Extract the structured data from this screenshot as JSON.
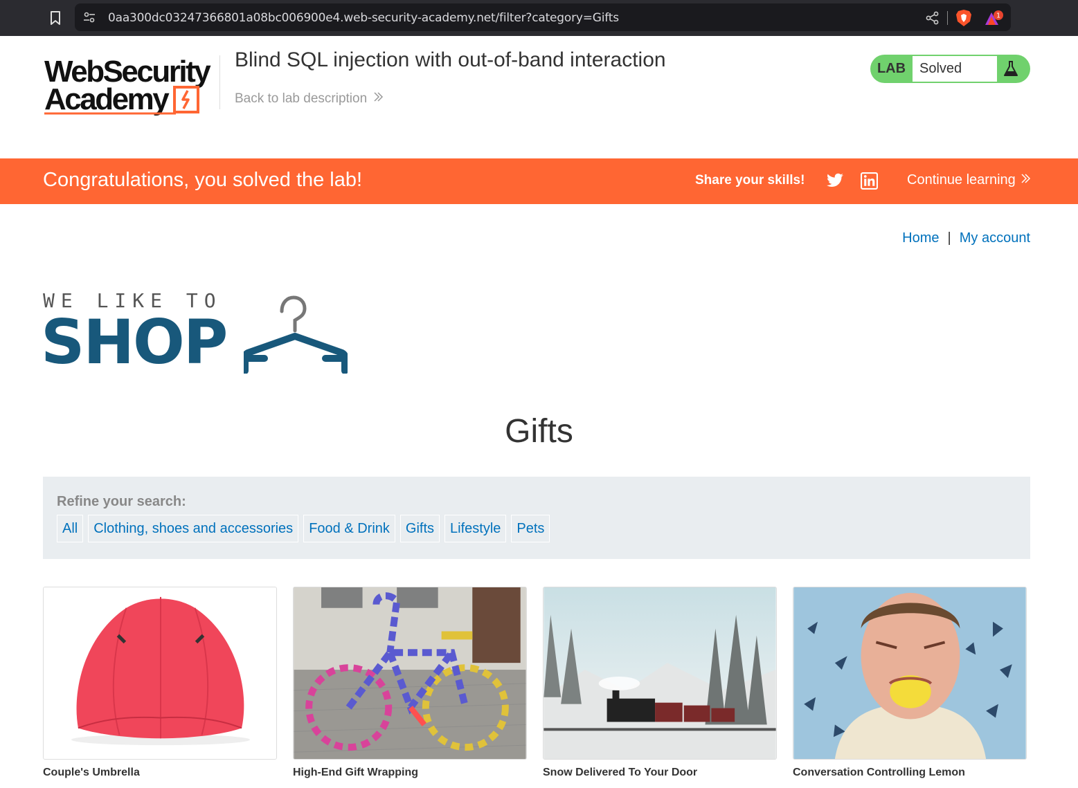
{
  "browser": {
    "url": "0aa300dc03247366801a08bc006900e4.web-security-academy.net/filter?category=Gifts",
    "rewards_count": "1"
  },
  "academy": {
    "logo_line1": "WebSecurity",
    "logo_line2": "Academy",
    "lab_title": "Blind SQL injection with out-of-band interaction",
    "back_link": "Back to lab description",
    "lab_label": "LAB",
    "lab_status": "Solved"
  },
  "banner": {
    "message": "Congratulations, you solved the lab!",
    "share_label": "Share your skills!",
    "continue_label": "Continue learning"
  },
  "nav": {
    "home": "Home",
    "separator": "|",
    "my_account": "My account"
  },
  "shop": {
    "tagline": "WE LIKE TO",
    "name": "SHOP"
  },
  "page_title": "Gifts",
  "filter": {
    "label": "Refine your search:",
    "categories": [
      "All",
      "Clothing, shoes and accessories",
      "Food & Drink",
      "Gifts",
      "Lifestyle",
      "Pets"
    ]
  },
  "products": [
    {
      "name": "Couple's Umbrella"
    },
    {
      "name": "High-End Gift Wrapping"
    },
    {
      "name": "Snow Delivered To Your Door"
    },
    {
      "name": "Conversation Controlling Lemon"
    }
  ],
  "colors": {
    "brand_orange": "#ff6633",
    "lab_green": "#70d16d",
    "link_blue": "#0071bc",
    "shop_blue": "#18587b"
  }
}
